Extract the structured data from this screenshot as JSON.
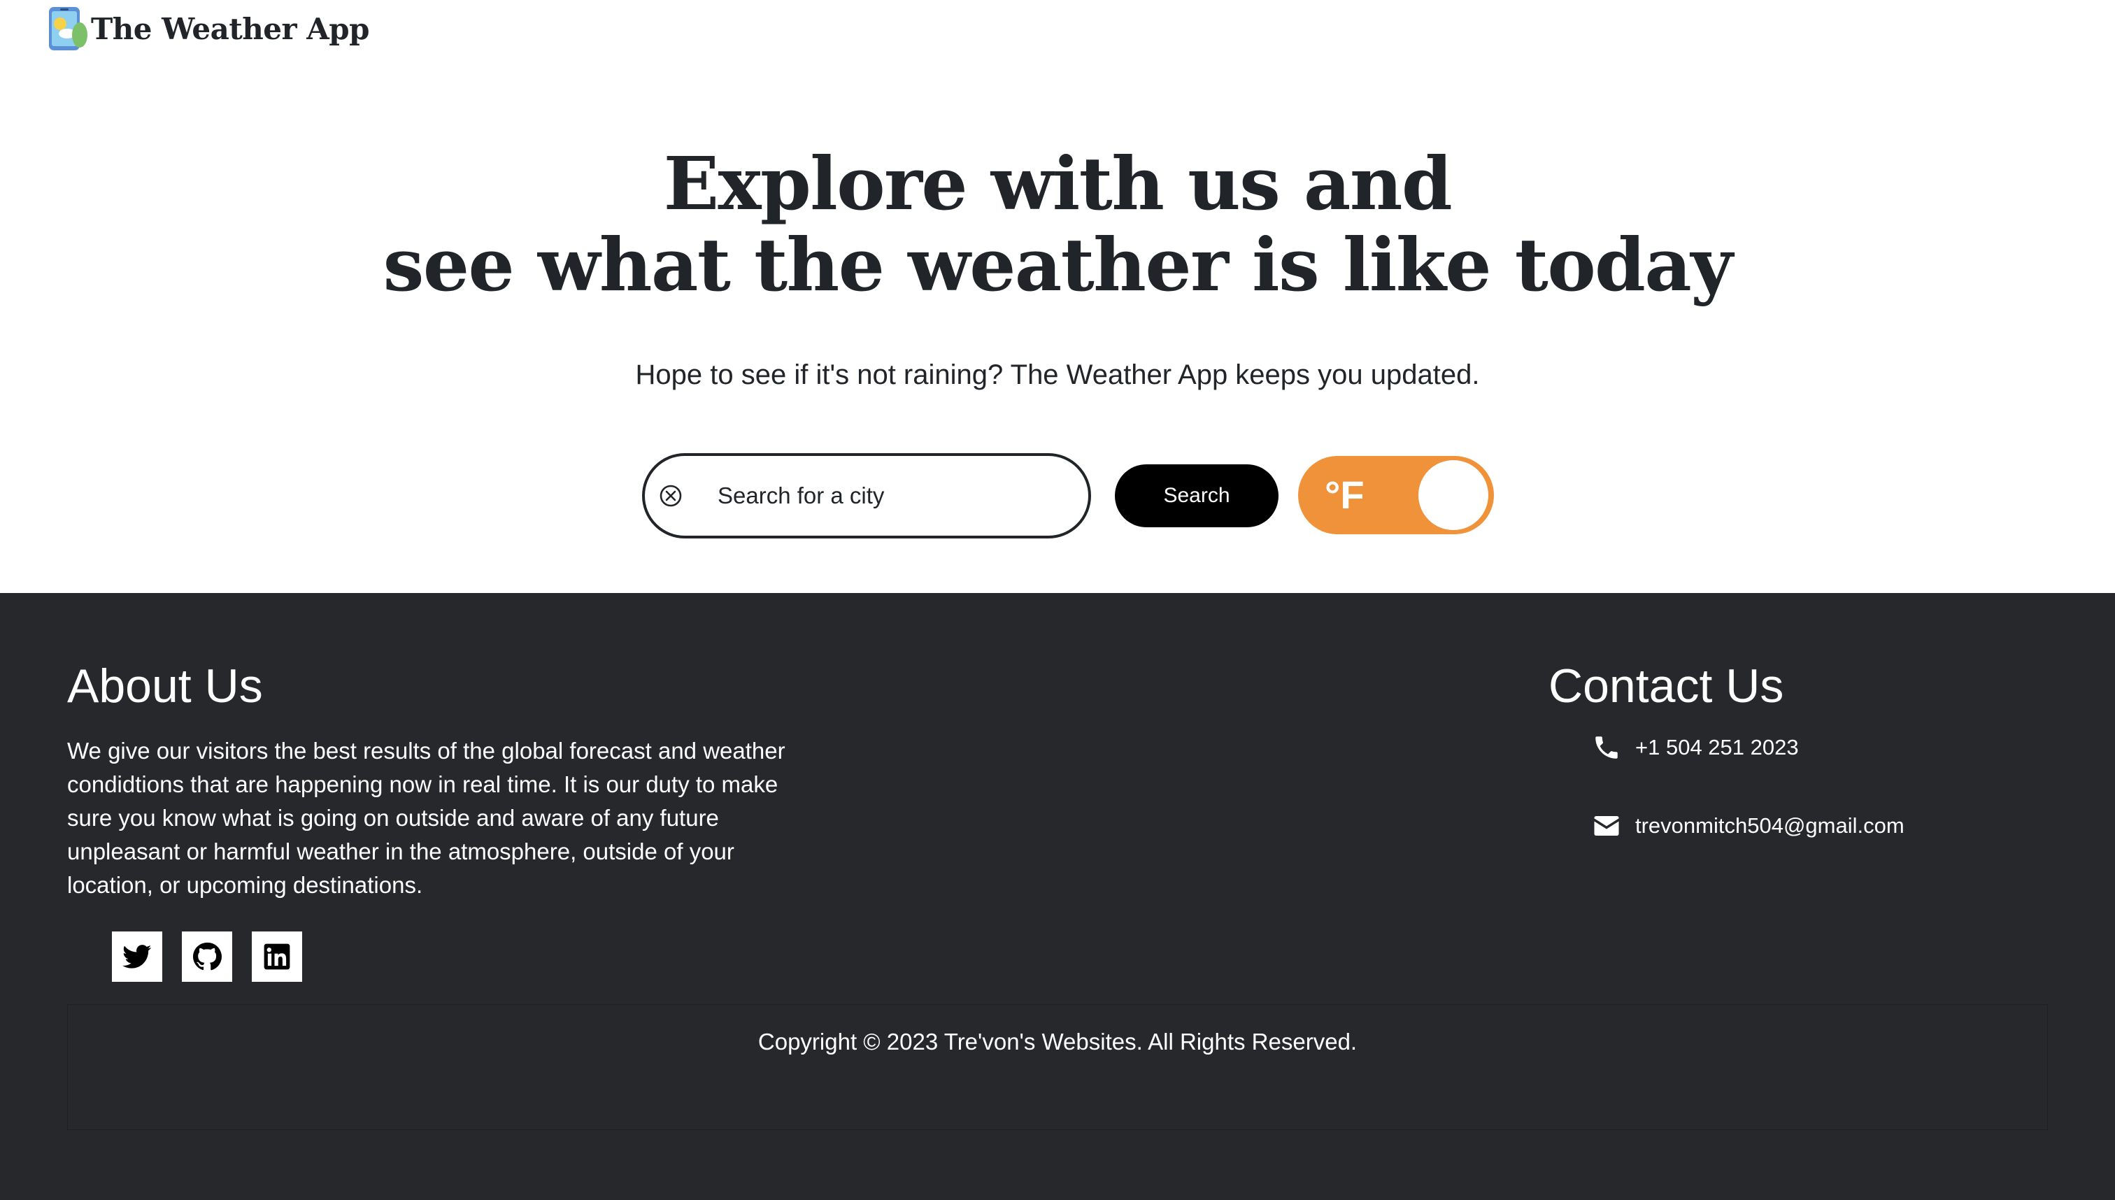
{
  "header": {
    "app_title": "The Weather App",
    "logo_icon": "weather-phone-logo-icon"
  },
  "hero": {
    "title_line1": "Explore with us and",
    "title_line2": "see what the weather is like today",
    "subtitle": "Hope to see if it's not raining? The Weather App keeps you updated."
  },
  "search": {
    "placeholder": "Search for a city",
    "value": "",
    "clear_icon": "clear-circle-x-icon",
    "button_label": "Search"
  },
  "unit_toggle": {
    "label": "°F",
    "color": "#f0923a"
  },
  "footer": {
    "background": "#27282b",
    "about": {
      "title": "About Us",
      "text": "We give our visitors the best results of the global forecast and weather condidtions that are happening now in real time. It is our duty to make sure you know what is going on outside and aware of any future unpleasant or harmful weather in the atmosphere, outside of your location, or upcoming destinations."
    },
    "socials": [
      {
        "icon": "twitter-icon"
      },
      {
        "icon": "github-icon"
      },
      {
        "icon": "linkedin-icon"
      }
    ],
    "contact": {
      "title": "Contact Us",
      "phone": "+1 504 251 2023",
      "phone_icon": "phone-icon",
      "email": "trevonmitch504@gmail.com",
      "email_icon": "envelope-icon"
    },
    "copyright": "Copyright © 2023 Tre'von's Websites. All Rights Reserved."
  }
}
